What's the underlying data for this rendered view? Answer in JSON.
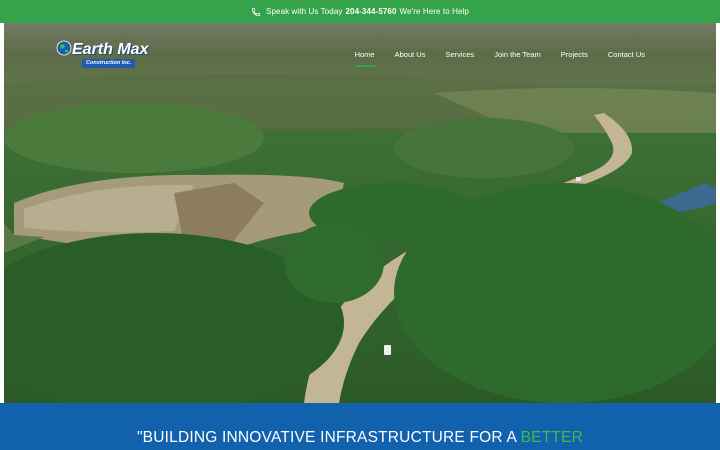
{
  "topbar": {
    "prefix": "Speak with Us Today",
    "phone": "204-344-5760",
    "suffix": "We're Here to Help",
    "icon": "phone-icon"
  },
  "logo": {
    "title": "Earth Max",
    "subtitle": "Construction Inc.",
    "icon": "globe-icon"
  },
  "nav": {
    "items": [
      {
        "label": "Home",
        "active": true
      },
      {
        "label": "About Us",
        "active": false
      },
      {
        "label": "Services",
        "active": false
      },
      {
        "label": "Join the Team",
        "active": false
      },
      {
        "label": "Projects",
        "active": false
      },
      {
        "label": "Contact Us",
        "active": false
      }
    ]
  },
  "hero": {
    "description_icon": "aerial-forest-road-image"
  },
  "banner": {
    "text_main": "\"BUILDING INNOVATIVE INFRASTRUCTURE FOR A ",
    "text_accent": "BETTER"
  },
  "colors": {
    "green_accent": "#34a34a",
    "brand_blue": "#1161ad"
  }
}
